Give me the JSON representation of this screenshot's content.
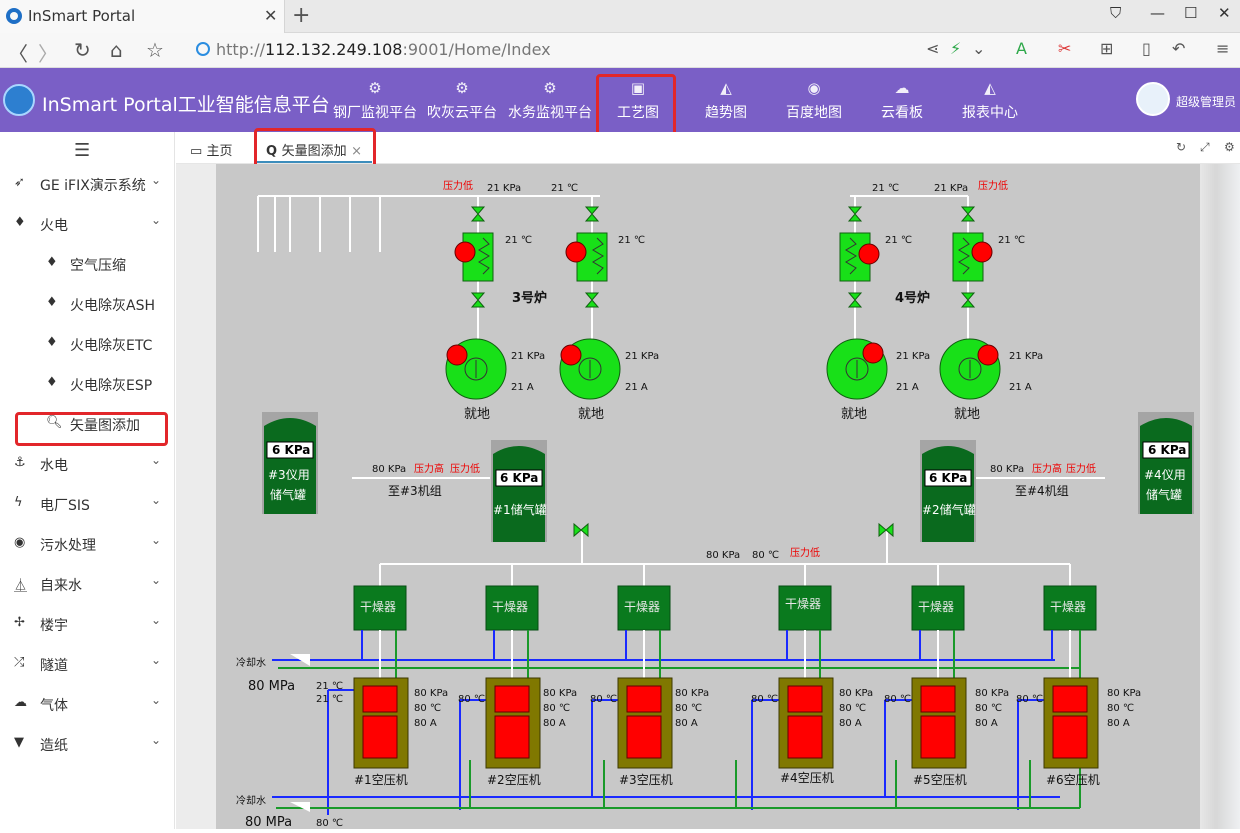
{
  "browser": {
    "tab_title": "InSmart Portal",
    "url_prefix": "http://",
    "url_host": "112.132.249.108",
    "url_rest": ":9001/Home/Index"
  },
  "header": {
    "brand": "InSmart Portal工业智能信息平台",
    "nav": [
      "钢厂监视平台",
      "吹灰云平台",
      "水务监视平台",
      "工艺图",
      "趋势图",
      "百度地图",
      "云看板",
      "报表中心"
    ],
    "user": "超级管理员"
  },
  "sidebar": {
    "items": [
      {
        "label": "GE iFIX演示系统",
        "icon": "paper-plane-icon"
      },
      {
        "label": "火电",
        "icon": "flame-icon"
      },
      {
        "label": "空气压缩",
        "icon": "flame-icon"
      },
      {
        "label": "火电除灰ASH",
        "icon": "flame-icon"
      },
      {
        "label": "火电除灰ETC",
        "icon": "flame-icon"
      },
      {
        "label": "火电除灰ESP",
        "icon": "flame-icon"
      },
      {
        "label": "矢量图添加",
        "icon": "search-icon"
      },
      {
        "label": "水电",
        "icon": "anchor-icon"
      },
      {
        "label": "电厂SIS",
        "icon": "bolt-icon"
      },
      {
        "label": "污水处理",
        "icon": "circle-icon"
      },
      {
        "label": "自来水",
        "icon": "flask-icon"
      },
      {
        "label": "楼宇",
        "icon": "fan-icon"
      },
      {
        "label": "隧道",
        "icon": "shuffle-icon"
      },
      {
        "label": "气体",
        "icon": "cloud-icon"
      },
      {
        "label": "造纸",
        "icon": "filter-icon"
      }
    ]
  },
  "tabs": {
    "home": "主页",
    "active": "矢量图添加"
  },
  "diagram": {
    "furnace3": "3号炉",
    "furnace4": "4号炉",
    "low_pressure": "压力低",
    "high_pressure": "压力高",
    "p21": "21 KPa",
    "t21": "21 ℃",
    "i21": "21 A",
    "p80": "80 KPa",
    "t80": "80 ℃",
    "i80": "80 A",
    "local": "就地",
    "tank6": "6 KPa",
    "inst3": "#3仪用",
    "inst4": "#4仪用",
    "gas_tank": "储气罐",
    "tank1": "#1储气罐",
    "tank2": "#2储气罐",
    "to3": "至#3机组",
    "to4": "至#4机组",
    "dryer": "干燥器",
    "cooling": "冷却水",
    "mpa80": "80 MPa",
    "compressors": [
      "#1空压机",
      "#2空压机",
      "#3空压机",
      "#4空压机",
      "#5空压机",
      "#6空压机"
    ]
  }
}
